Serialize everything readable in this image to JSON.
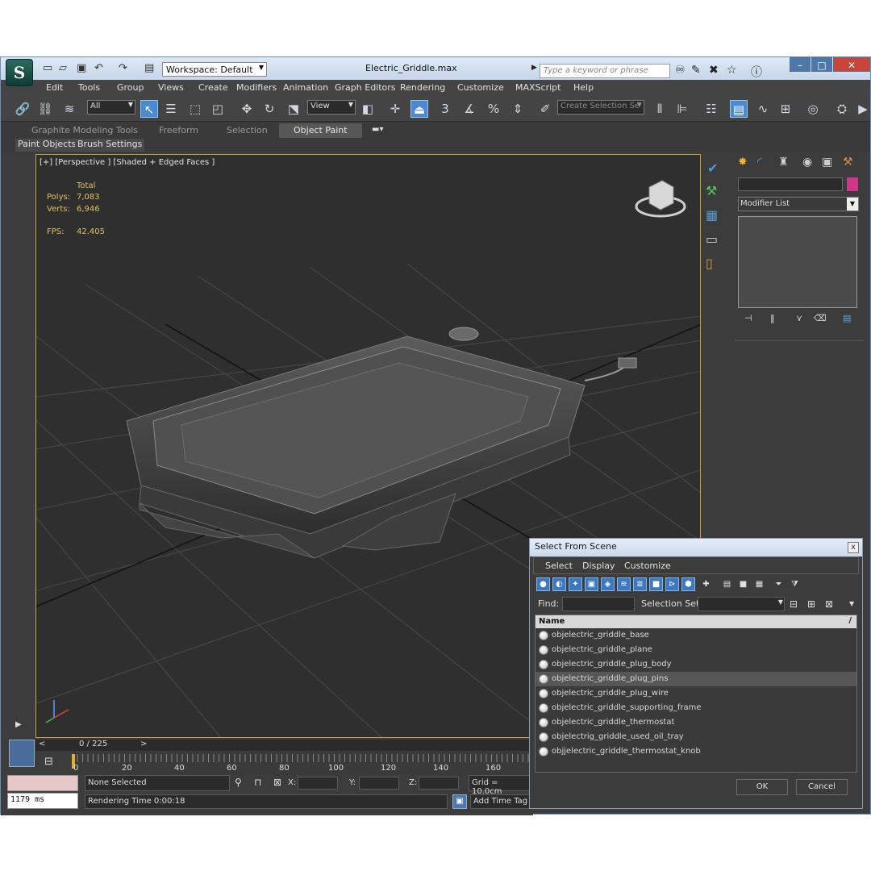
{
  "window": {
    "title": "Electric_Griddle.max",
    "workspace": "Workspace: Default",
    "search_placeholder": "Type a keyword or phrase"
  },
  "menu": [
    "Edit",
    "Tools",
    "Group",
    "Views",
    "Create",
    "Modifiers",
    "Animation",
    "Graph Editors",
    "Rendering",
    "Customize",
    "MAXScript",
    "Help"
  ],
  "toolbar": {
    "selection_filter": "All",
    "ref_coord": "View",
    "selection_set": "Create Selection Se",
    "snap_labels": [
      "3",
      "%"
    ]
  },
  "ribbon": {
    "tabs": [
      "Graphite Modeling Tools",
      "Freeform",
      "Selection",
      "Object Paint"
    ],
    "active_tab": "Object Paint",
    "subtabs": [
      "Paint Objects",
      "Brush Settings"
    ]
  },
  "viewport": {
    "label": "[+] [Perspective ] [Shaded + Edged Faces ]",
    "stats_header": "Total",
    "polys_label": "Polys:",
    "polys": "7,083",
    "verts_label": "Verts:",
    "verts": "6,946",
    "fps_label": "FPS:",
    "fps": "42.405"
  },
  "command_panel": {
    "modifier_list": "Modifier List",
    "swatch_color": "#d0368a"
  },
  "timeline": {
    "frame": "0 / 225",
    "ticks": [
      "0",
      "20",
      "40",
      "60",
      "80",
      "100",
      "120",
      "140",
      "160"
    ]
  },
  "status": {
    "selection": "None Selected",
    "x_label": "X:",
    "y_label": "Y:",
    "z_label": "Z:",
    "grid": "Grid = 10.0cm",
    "render_time": "Rendering Time  0:00:18",
    "add_time_tag": "Add Time Tag",
    "ms": "1179 ms"
  },
  "dialog": {
    "title": "Select From Scene",
    "close": "x",
    "menu": [
      "Select",
      "Display",
      "Customize"
    ],
    "find_label": "Find:",
    "selection_set_label": "Selection Set:",
    "column_name": "Name",
    "items": [
      "objelectric_griddle_base",
      "objelectric_griddle_plane",
      "objelectric_griddle_plug_body",
      "objelectric_griddle_plug_pins",
      "objelectric_griddle_plug_wire",
      "objelectric_griddle_supporting_frame",
      "objelectric_griddle_thermostat",
      "objelectrig_griddle_used_oil_tray",
      "objjelectric_griddle_thermostat_knob"
    ],
    "selected_index": 3,
    "ok": "OK",
    "cancel": "Cancel"
  }
}
